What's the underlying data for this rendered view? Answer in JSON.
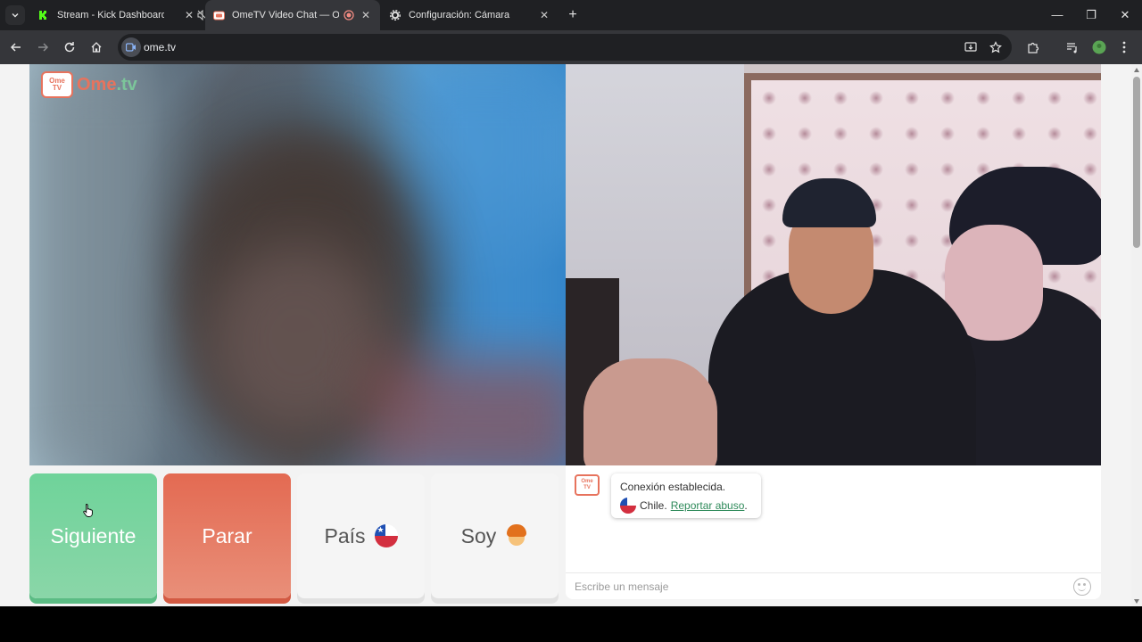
{
  "browser": {
    "tabs": [
      {
        "title": "Stream - Kick Dashboard",
        "favicon": "kick-logo-icon",
        "muted": true
      },
      {
        "title": "OmeTV Video Chat — Ome",
        "favicon": "ometv-favicon-icon",
        "recording": true,
        "active": true
      },
      {
        "title": "Configuración: Cámara",
        "favicon": "gear-icon"
      }
    ],
    "new_tab_label": "+",
    "url": "ome.tv"
  },
  "site": {
    "logo_prefix": "Ome",
    "logo_suffix": ".tv",
    "logo_badge_top": "Ome",
    "logo_badge_bottom": "TV"
  },
  "controls": {
    "next_label": "Siguiente",
    "stop_label": "Parar",
    "country_label": "País",
    "gender_label": "Soy"
  },
  "chat": {
    "badge_top": "Ome",
    "badge_bottom": "TV",
    "status": "Conexión establecida.",
    "country": "Chile.",
    "report_link": "Reportar abuso",
    "report_suffix": ".",
    "input_placeholder": "Escribe un mensaje"
  },
  "colors": {
    "next_button": "#6fd39a",
    "stop_button": "#e36a52",
    "brand": "#e7735d",
    "link": "#2e8a5a"
  }
}
